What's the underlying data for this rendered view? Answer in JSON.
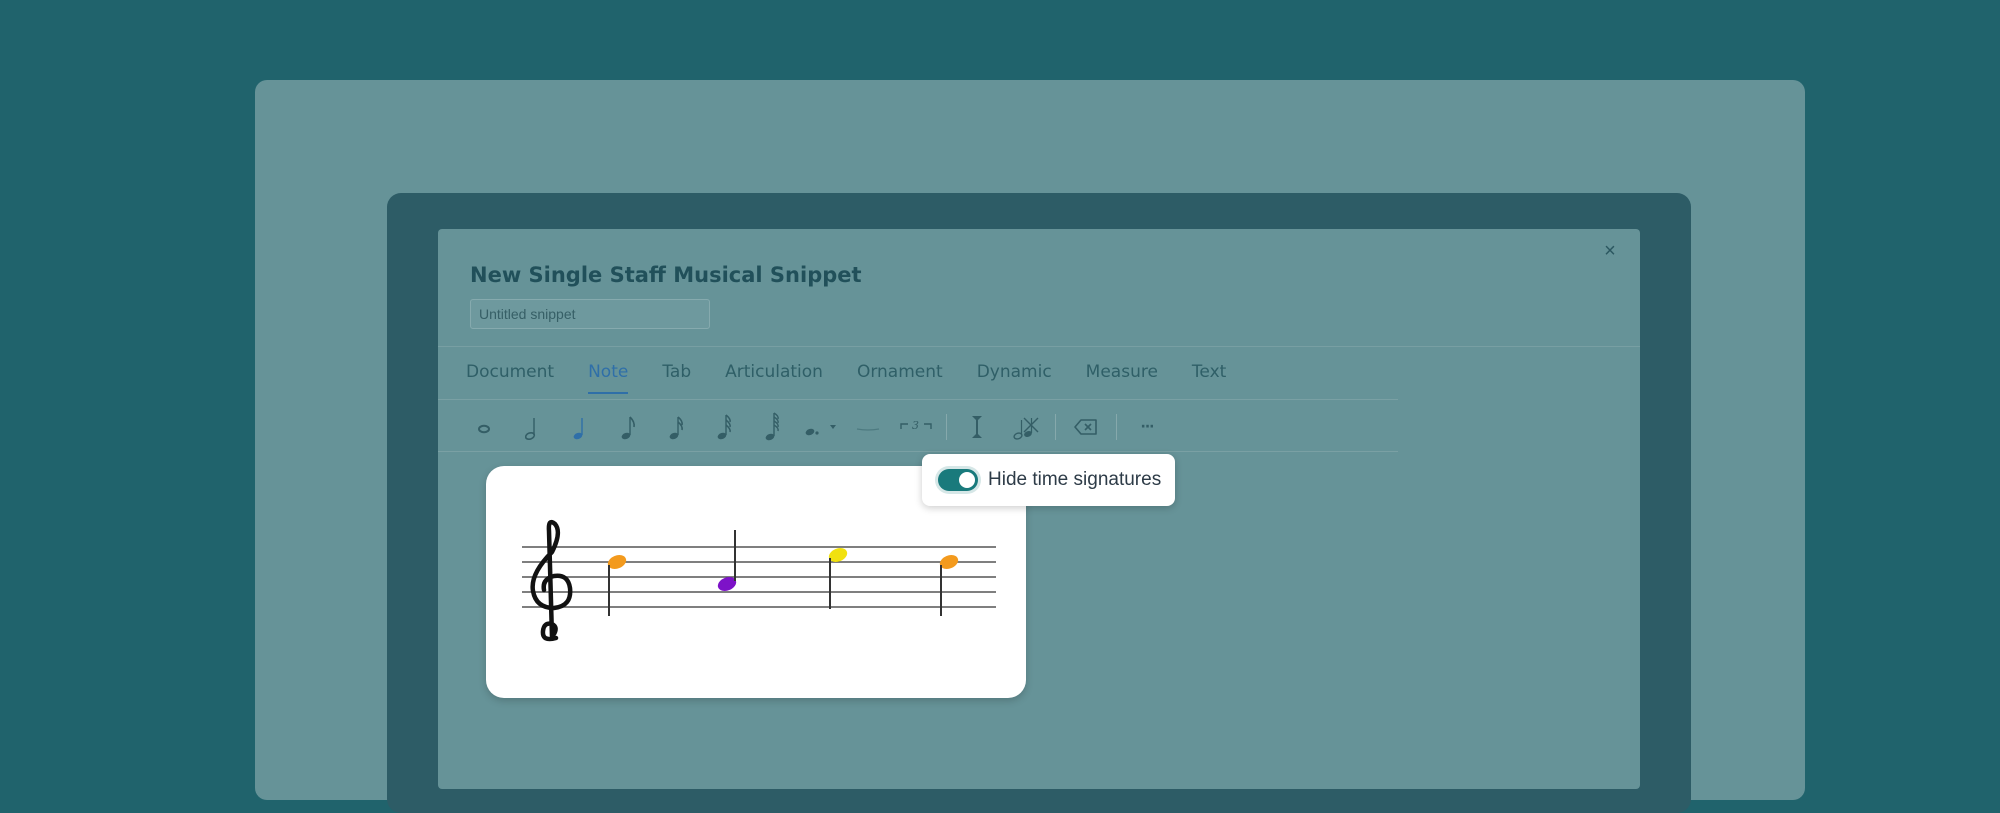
{
  "dialog": {
    "title": "New Single Staff Musical Snippet",
    "title_placeholder": "Untitled snippet",
    "close_label": "×"
  },
  "tabs": [
    {
      "label": "Document",
      "active": false
    },
    {
      "label": "Note",
      "active": true
    },
    {
      "label": "Tab",
      "active": false
    },
    {
      "label": "Articulation",
      "active": false
    },
    {
      "label": "Ornament",
      "active": false
    },
    {
      "label": "Dynamic",
      "active": false
    },
    {
      "label": "Measure",
      "active": false
    },
    {
      "label": "Text",
      "active": false
    }
  ],
  "toolbar": {
    "items": [
      {
        "name": "whole-note-icon",
        "active": false
      },
      {
        "name": "half-note-icon",
        "active": false
      },
      {
        "name": "quarter-note-icon",
        "active": true
      },
      {
        "name": "eighth-note-icon",
        "active": false
      },
      {
        "name": "sixteenth-note-icon",
        "active": false
      },
      {
        "name": "thirty-second-note-icon",
        "active": false
      },
      {
        "name": "sixty-fourth-note-icon",
        "active": false
      },
      {
        "name": "dotted-note-icon",
        "active": false
      },
      {
        "name": "tie-icon",
        "active": false
      },
      {
        "name": "tuplet-icon",
        "active": false,
        "text": "3"
      },
      {
        "name": "text-cursor-icon",
        "active": false
      },
      {
        "name": "rest-toggle-icon",
        "active": false
      },
      {
        "name": "backspace-icon",
        "active": false
      },
      {
        "name": "more-icon",
        "active": false,
        "text": "···"
      }
    ]
  },
  "snippet": {
    "clef": "treble",
    "notes": [
      {
        "pitch": "C5",
        "duration": "quarter",
        "color": "#f39a1d"
      },
      {
        "pitch": "G4",
        "duration": "quarter",
        "color": "#7d12c8"
      },
      {
        "pitch": "D5",
        "duration": "quarter",
        "color": "#f1e10f"
      },
      {
        "pitch": "C5",
        "duration": "quarter",
        "color": "#f39a1d"
      }
    ]
  },
  "toggle": {
    "label": "Hide time signatures",
    "on": true,
    "color": "#197a7c"
  },
  "colors": {
    "background": "#20636c",
    "panel": "#669398",
    "accent": "#2f6fa8"
  }
}
